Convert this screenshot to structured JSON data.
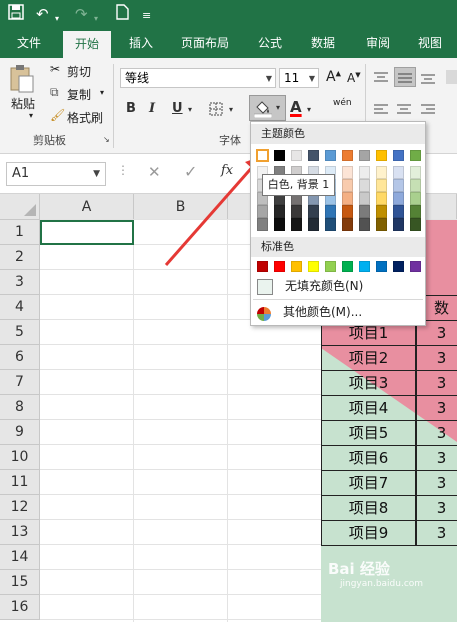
{
  "quick_access": {
    "save_icon": "save-icon",
    "undo_icon": "undo-icon",
    "redo_icon": "redo-icon",
    "new_icon": "new-file-icon",
    "customize_icon": "customize-qat-icon"
  },
  "tabs": [
    "文件",
    "开始",
    "插入",
    "页面布局",
    "公式",
    "数据",
    "审阅",
    "视图"
  ],
  "active_tab": "开始",
  "ribbon": {
    "clipboard": {
      "paste": "粘贴",
      "cut": "剪切",
      "copy": "复制",
      "format_painter": "格式刷",
      "group_label": "剪贴板"
    },
    "font": {
      "font_name": "等线",
      "font_size": "11",
      "bold": "B",
      "italic": "I",
      "underline": "U",
      "group_label": "字体",
      "phonetic": "wén"
    }
  },
  "formula_bar": {
    "name_box": "A1",
    "fx": "fx"
  },
  "columns": [
    "A",
    "B"
  ],
  "rows": [
    "1",
    "2",
    "3",
    "4",
    "5",
    "6",
    "7",
    "8",
    "9",
    "10",
    "11",
    "12",
    "13",
    "14",
    "15",
    "16"
  ],
  "sheet": {
    "header_partial": "数",
    "items": [
      "项目1",
      "项目2",
      "项目3",
      "项目4",
      "项目5",
      "项目6",
      "项目7",
      "项目8",
      "项目9"
    ],
    "partial_values": [
      "3",
      "3",
      "3",
      "3",
      "3",
      "3",
      "3",
      "3",
      "3"
    ]
  },
  "dropdown": {
    "theme_colors_label": "主题颜色",
    "standard_colors_label": "标准色",
    "no_fill": "无填充颜色(N)",
    "more_colors": "其他颜色(M)...",
    "theme_top": [
      "#FFFFFF",
      "#000000",
      "#E7E6E6",
      "#44546A",
      "#5B9BD5",
      "#ED7D31",
      "#A5A5A5",
      "#FFC000",
      "#4472C4",
      "#70AD47"
    ],
    "theme_shades": [
      [
        "#F2F2F2",
        "#808080",
        "#D0CECE",
        "#D6DCE4",
        "#DDEBF7",
        "#FCE4D6",
        "#EDEDED",
        "#FFF2CC",
        "#D9E1F2",
        "#E2EFDA"
      ],
      [
        "#D9D9D9",
        "#595959",
        "#AEAAAA",
        "#ACB9CA",
        "#BDD7EE",
        "#F8CBAD",
        "#DBDBDB",
        "#FFE699",
        "#B4C6E7",
        "#C6E0B4"
      ],
      [
        "#BFBFBF",
        "#404040",
        "#757171",
        "#8497B0",
        "#9BC2E6",
        "#F4B084",
        "#C9C9C9",
        "#FFD966",
        "#8EA9DB",
        "#A9D08E"
      ],
      [
        "#A6A6A6",
        "#262626",
        "#3A3838",
        "#333F4F",
        "#2F75B5",
        "#C65911",
        "#7B7B7B",
        "#BF8F00",
        "#305496",
        "#548235"
      ],
      [
        "#808080",
        "#0D0D0D",
        "#161616",
        "#222B35",
        "#1F4E78",
        "#833C0C",
        "#525252",
        "#806000",
        "#203764",
        "#375623"
      ]
    ],
    "standard": [
      "#C00000",
      "#FF0000",
      "#FFC000",
      "#FFFF00",
      "#92D050",
      "#00B050",
      "#00B0F0",
      "#0070C0",
      "#002060",
      "#7030A0"
    ]
  },
  "tooltip": "白色, 背景 1",
  "colors": {
    "excel_green": "#217346",
    "pink_fill": "#E88FA0",
    "green_fill": "#C7E2CF",
    "arrow_red": "#E53935"
  },
  "watermark": {
    "text": "Bai 经验",
    "url": "jingyan.baidu.com"
  }
}
